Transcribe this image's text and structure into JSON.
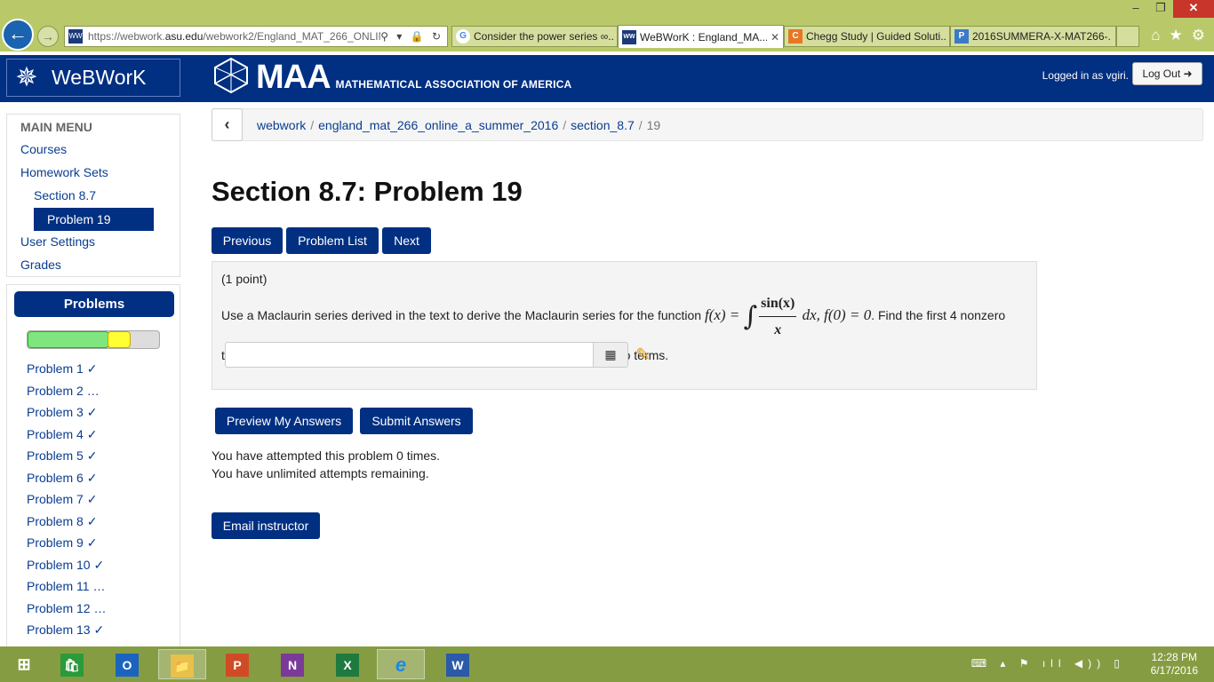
{
  "browser": {
    "window_controls": [
      "–",
      "❐",
      "✕"
    ],
    "address": {
      "url_prefix": "https://webwork.",
      "url_domain": "asu.edu",
      "url_rest": "/webwork2/England_MAT_266_ONLINI",
      "actions": "⚲ ▾ 🔒 ↻"
    },
    "tabs": [
      {
        "icon": "G",
        "label": "Consider the power series ∞...",
        "close": ""
      },
      {
        "icon": "WW",
        "label": "WeBWorK : England_MA...",
        "close": "✕"
      },
      {
        "icon": "C",
        "label": "Chegg Study | Guided Soluti...",
        "close": ""
      },
      {
        "icon": "P",
        "label": "2016SUMMERA-X-MAT266-...",
        "close": ""
      }
    ],
    "right_icons": [
      "⌂",
      "★",
      "⚙"
    ]
  },
  "header": {
    "brand": "WeBWorK",
    "maa_big": "MAA",
    "maa_small": "MATHEMATICAL ASSOCIATION OF AMERICA",
    "logged_in": "Logged in as vgiri.",
    "logout": "Log Out ➜"
  },
  "main_menu": {
    "heading": "MAIN MENU",
    "items": [
      "Courses",
      "Homework Sets",
      "Section 8.7",
      "Problem 19",
      "User Settings",
      "Grades"
    ]
  },
  "problems_panel": {
    "heading": "Problems",
    "progress": {
      "correct_fraction": 0.61,
      "partial_fraction": 0.17
    },
    "items": [
      "Problem 1 ✓",
      "Problem 2 …",
      "Problem 3 ✓",
      "Problem 4 ✓",
      "Problem 5 ✓",
      "Problem 6 ✓",
      "Problem 7 ✓",
      "Problem 8 ✓",
      "Problem 9 ✓",
      "Problem 10 ✓",
      "Problem 11 …",
      "Problem 12 …",
      "Problem 13 ✓"
    ]
  },
  "breadcrumb": {
    "back": "‹",
    "items": [
      "webwork",
      "england_mat_266_online_a_summer_2016",
      "section_8.7"
    ],
    "current": "19",
    "separator": "/"
  },
  "page": {
    "title": "Section 8.7: Problem 19",
    "nav": [
      "Previous",
      "Problem List",
      "Next"
    ]
  },
  "problem": {
    "points": "(1 point)",
    "text_before": "Use a Maclaurin series derived in the text to derive the Maclaurin series for the function ",
    "math_f": "f(x) = ",
    "integral": "∫",
    "frac_num": "sin(x)",
    "frac_den": "x",
    "math_after": " dx, f(0) = 0",
    "text_after": ". Find the first 4 nonzero terms in the series, that is write down the Taylor polynomial with 4 nonzero terms.",
    "answer_value": "",
    "grid_icon": "▦",
    "pencil_icon": "✎"
  },
  "actions": {
    "preview": "Preview My Answers",
    "submit": "Submit Answers",
    "attempts": "You have attempted this problem 0 times.",
    "remaining": "You have unlimited attempts remaining.",
    "email": "Email instructor"
  },
  "taskbar": {
    "apps": [
      {
        "icon": "start-icon",
        "label": "⊞"
      },
      {
        "icon": "store-icon",
        "label": "🛍"
      },
      {
        "icon": "outlook-icon",
        "label": "O"
      },
      {
        "icon": "file-explorer-icon",
        "label": "📁"
      },
      {
        "icon": "powerpoint-icon",
        "label": "P"
      },
      {
        "icon": "onenote-icon",
        "label": "N"
      },
      {
        "icon": "excel-icon",
        "label": "X"
      },
      {
        "icon": "internet-explorer-icon",
        "label": "e"
      },
      {
        "icon": "word-icon",
        "label": "W"
      }
    ],
    "tray": "⌨ ▴ ⚑ ıll ◀)) ▯",
    "time": "12:28 PM",
    "date": "6/17/2016"
  },
  "colors": {
    "navy": "#012f82",
    "chrome": "#b9c96a",
    "taskbar": "#869c43"
  }
}
